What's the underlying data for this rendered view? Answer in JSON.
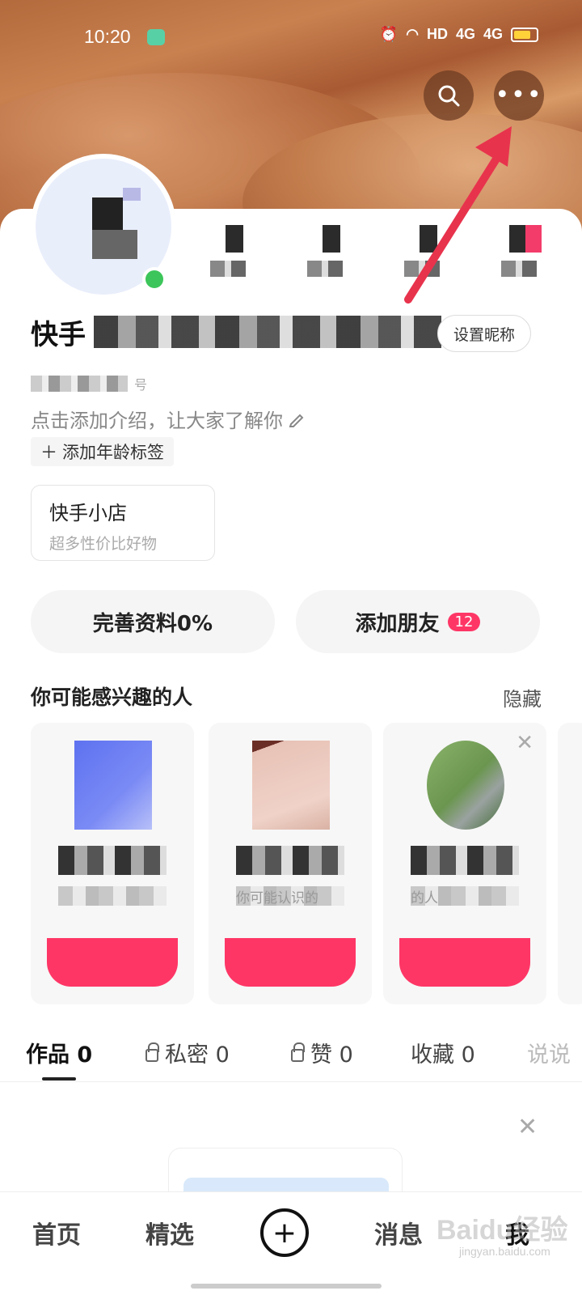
{
  "status_bar": {
    "time": "10:20",
    "indicators": "HD",
    "network1": "4G",
    "network2": "4G"
  },
  "header": {
    "search_icon": "search-icon",
    "more_icon": "more-dots-icon",
    "more_label": "•••"
  },
  "profile": {
    "name": "快手",
    "set_nickname_button": "设置昵称",
    "id_suffix": "号",
    "intro_placeholder": "点击添加介绍，让大家了解你",
    "age_tag": "添加年龄标签"
  },
  "shop": {
    "title": "快手小店",
    "subtitle": "超多性价比好物"
  },
  "actions": {
    "complete_profile": "完善资料0%",
    "add_friends": "添加朋友",
    "add_friends_badge": "12"
  },
  "recommendations": {
    "title": "你可能感兴趣的人",
    "hide": "隐藏",
    "cards": [
      {
        "reason": ""
      },
      {
        "reason": "你可能认识的"
      },
      {
        "reason": "的人"
      }
    ]
  },
  "tabs": [
    {
      "label": "作品 0"
    },
    {
      "label": "私密 0"
    },
    {
      "label": "赞 0"
    },
    {
      "label": "收藏 0"
    },
    {
      "label": "说说"
    }
  ],
  "bottom_nav": {
    "home": "首页",
    "featured": "精选",
    "plus": "+",
    "messages": "消息",
    "me": "我"
  },
  "watermark": {
    "main": "Baidu经验",
    "sub": "jingyan.baidu.com"
  },
  "colors": {
    "accent": "#fe3666",
    "online": "#3cc55a",
    "arrow": "#e8334d"
  }
}
